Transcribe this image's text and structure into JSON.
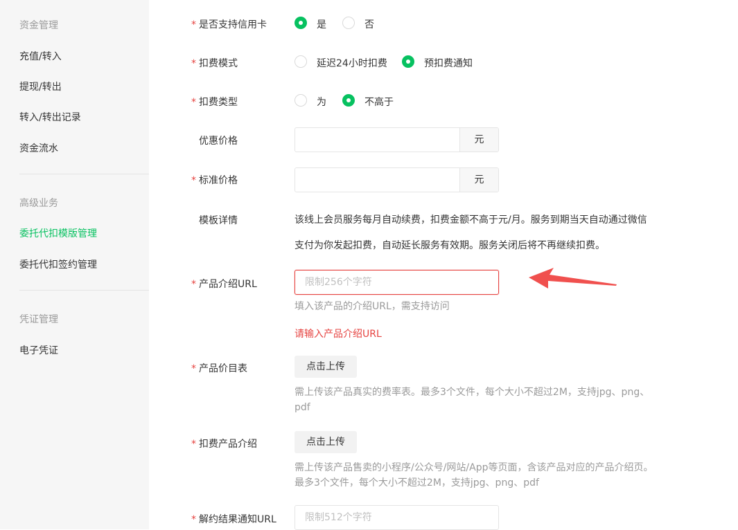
{
  "sidebar": {
    "sections": [
      {
        "heading": "资金管理",
        "items": [
          "充值/转入",
          "提现/转出",
          "转入/转出记录",
          "资金流水"
        ]
      },
      {
        "heading": "高级业务",
        "items": [
          "委托代扣模版管理",
          "委托代扣签约管理"
        ]
      },
      {
        "heading": "凭证管理",
        "items": [
          "电子凭证"
        ]
      }
    ],
    "active_item": "委托代扣模版管理"
  },
  "form": {
    "required_mark": "*",
    "credit_card": {
      "label": "是否支持信用卡",
      "options": [
        "是",
        "否"
      ],
      "selected": "是"
    },
    "deduct_mode": {
      "label": "扣费模式",
      "options": [
        "延迟24小时扣费",
        "预扣费通知"
      ],
      "selected": "预扣费通知"
    },
    "deduct_type": {
      "label": "扣费类型",
      "options": [
        "为",
        "不高于"
      ],
      "selected": "不高于"
    },
    "discount_price": {
      "label": "优惠价格",
      "value": "",
      "suffix": "元"
    },
    "standard_price": {
      "label": "标准价格",
      "value": "",
      "suffix": "元"
    },
    "template_detail": {
      "label": "模板详情",
      "line1": "该线上会员服务每月自动续费，扣费金额不高于元/月。服务到期当天自动通过微信",
      "line2": "支付为你发起扣费，自动延长服务有效期。服务关闭后将不再继续扣费。"
    },
    "product_url": {
      "label": "产品介绍URL",
      "placeholder": "限制256个字符",
      "value": "",
      "hint": "填入该产品的介绍URL，需支持访问",
      "error": "请输入产品介绍URL"
    },
    "price_list": {
      "label": "产品价目表",
      "button": "点击上传",
      "hint": "需上传该产品真实的费率表。最多3个文件，每个大小不超过2M，支持jpg、png、pdf"
    },
    "product_intro": {
      "label": "扣费产品介绍",
      "button": "点击上传",
      "hint": "需上传该产品售卖的小程序/公众号/网站/App等页面，含该产品对应的产品介绍页。最多3个文件，每个大小不超过2M，支持jpg、png、pdf"
    },
    "cancel_notify_url": {
      "label": "解约结果通知URL",
      "placeholder": "限制512个字符",
      "value": ""
    }
  },
  "colors": {
    "accent": "#07c160",
    "error": "#e64340",
    "arrow": "#f0504e"
  },
  "annotation": {
    "icon": "red-arrow-icon"
  }
}
